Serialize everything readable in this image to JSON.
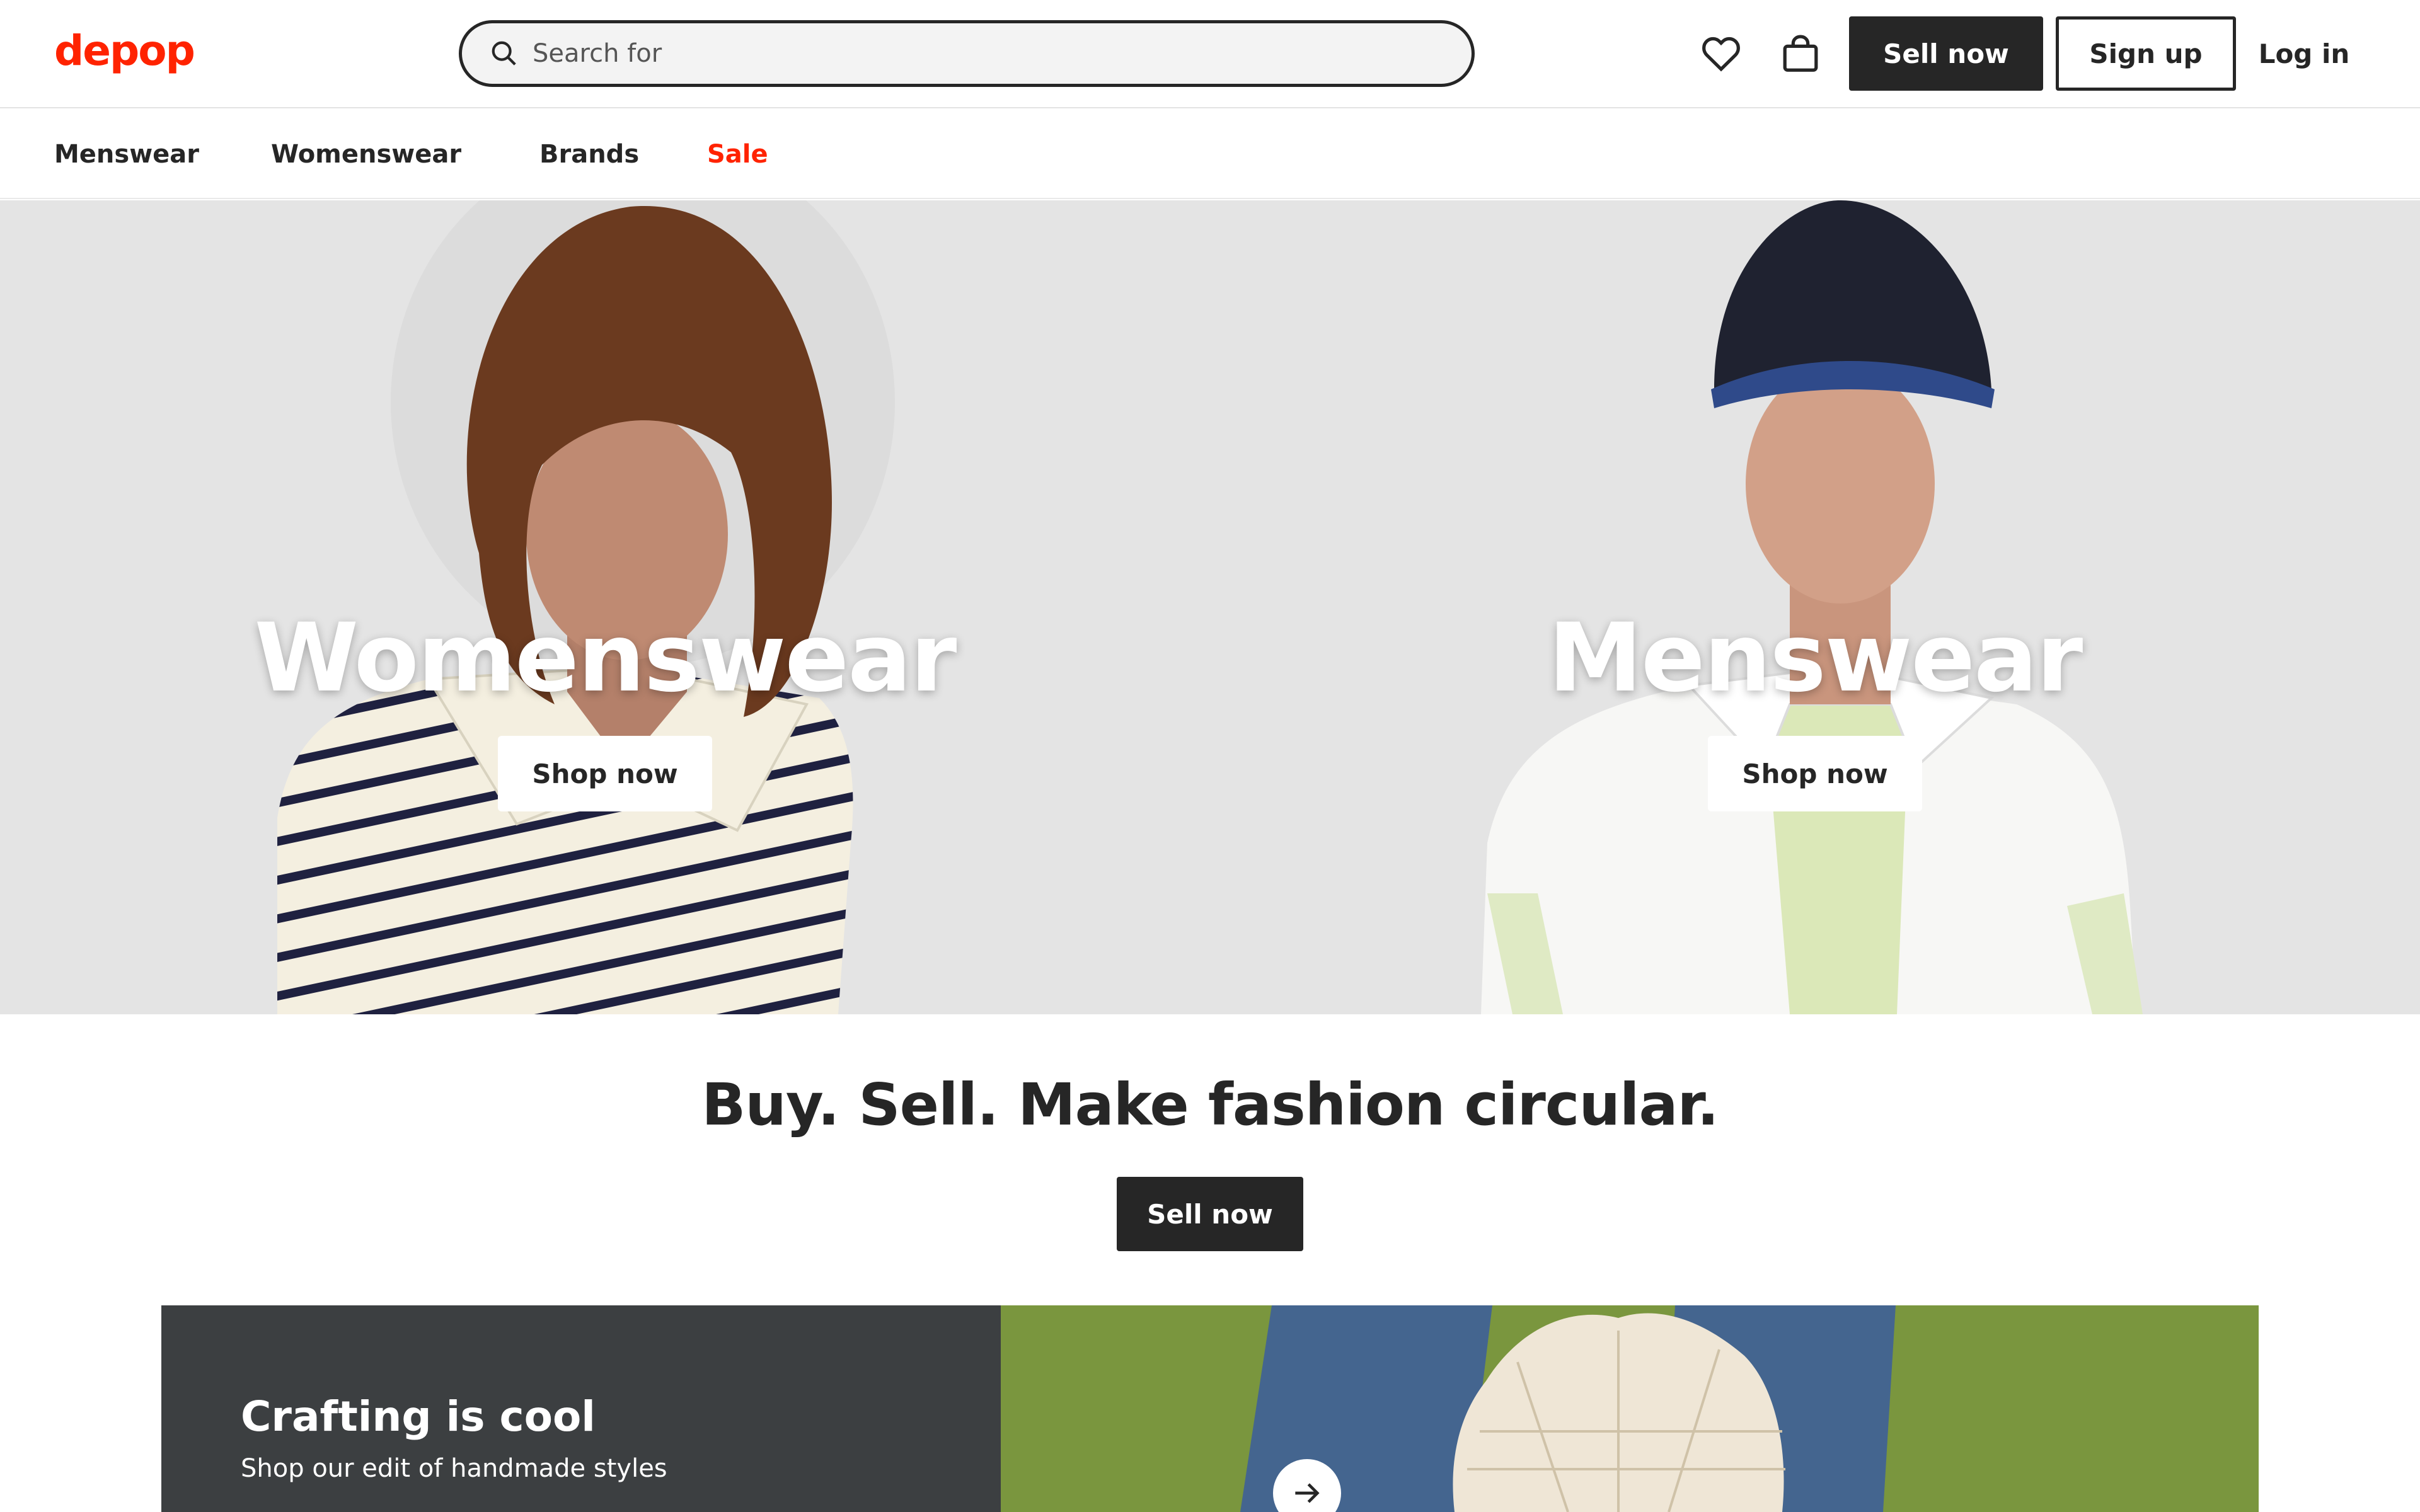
{
  "header": {
    "logo": "depop",
    "search_placeholder": "Search for",
    "sell_now": "Sell now",
    "sign_up": "Sign up",
    "log_in": "Log in"
  },
  "nav": {
    "items": [
      {
        "label": "Menswear"
      },
      {
        "label": "Womenswear"
      },
      {
        "label": "Brands"
      },
      {
        "label": "Sale"
      }
    ],
    "sale_color": "#ff2300"
  },
  "hero": {
    "left": {
      "title": "Womenswear",
      "button": "Shop now"
    },
    "right": {
      "title": "Menswear",
      "button": "Shop now"
    }
  },
  "tagline": {
    "text": "Buy. Sell. Make fashion circular.",
    "button": "Sell now"
  },
  "promo": {
    "title": "Crafting is cool",
    "subtitle": "Shop our edit of handmade styles"
  },
  "colors": {
    "brand": "#ff2300",
    "dark": "#262626",
    "promo_panel": "#3c3f41",
    "hero_bg": "#e4e4e4"
  }
}
